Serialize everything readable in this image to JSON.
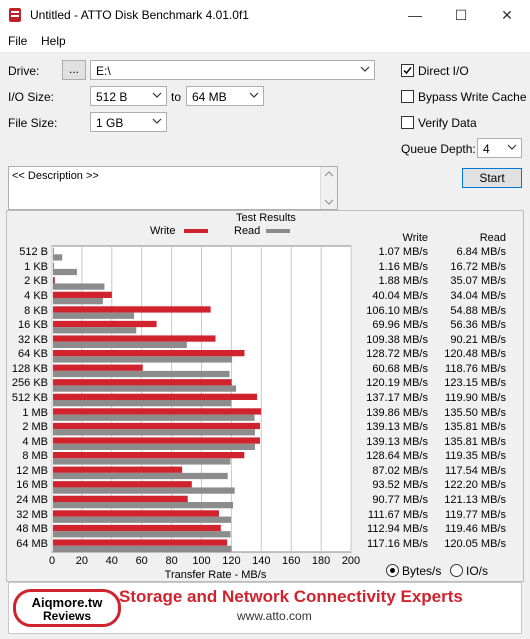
{
  "window": {
    "title": "Untitled - ATTO Disk Benchmark 4.01.0f1",
    "minimize_glyph": "—",
    "maximize_glyph": "☐",
    "close_glyph": "✕"
  },
  "menu": {
    "file": "File",
    "help": "Help"
  },
  "settings": {
    "drive_label": "Drive:",
    "browse_button": "...",
    "drive_value": "E:\\",
    "io_size_label": "I/O Size:",
    "io_from": "512 B",
    "io_to_label": "to",
    "io_to": "64 MB",
    "file_size_label": "File Size:",
    "file_size_value": "1 GB",
    "direct_io_label": "Direct I/O",
    "direct_io_checked": true,
    "bypass_cache_label": "Bypass Write Cache",
    "bypass_cache_checked": false,
    "verify_label": "Verify Data",
    "verify_checked": false,
    "queue_depth_label": "Queue Depth:",
    "queue_depth_value": "4",
    "start_button": "Start"
  },
  "description": {
    "text": "<< Description >>"
  },
  "results": {
    "title": "Test Results",
    "legend_write": "Write",
    "legend_read": "Read",
    "col_write": "Write",
    "col_read": "Read",
    "write_color": "#d0232e",
    "read_color": "#8c8c8c",
    "units_bytes": "Bytes/s",
    "units_io": "IO/s",
    "units_selected": "bytes",
    "rows": [
      {
        "size": "512 B",
        "write": "1.07 MB/s",
        "read": "6.84 MB/s"
      },
      {
        "size": "1 KB",
        "write": "1.16 MB/s",
        "read": "16.72 MB/s"
      },
      {
        "size": "2 KB",
        "write": "1.88 MB/s",
        "read": "35.07 MB/s"
      },
      {
        "size": "4 KB",
        "write": "40.04 MB/s",
        "read": "34.04 MB/s"
      },
      {
        "size": "8 KB",
        "write": "106.10 MB/s",
        "read": "54.88 MB/s"
      },
      {
        "size": "16 KB",
        "write": "69.96 MB/s",
        "read": "56.36 MB/s"
      },
      {
        "size": "32 KB",
        "write": "109.38 MB/s",
        "read": "90.21 MB/s"
      },
      {
        "size": "64 KB",
        "write": "128.72 MB/s",
        "read": "120.48 MB/s"
      },
      {
        "size": "128 KB",
        "write": "60.68 MB/s",
        "read": "118.76 MB/s"
      },
      {
        "size": "256 KB",
        "write": "120.19 MB/s",
        "read": "123.15 MB/s"
      },
      {
        "size": "512 KB",
        "write": "137.17 MB/s",
        "read": "119.90 MB/s"
      },
      {
        "size": "1 MB",
        "write": "139.86 MB/s",
        "read": "135.50 MB/s"
      },
      {
        "size": "2 MB",
        "write": "139.13 MB/s",
        "read": "135.81 MB/s"
      },
      {
        "size": "4 MB",
        "write": "139.13 MB/s",
        "read": "135.81 MB/s"
      },
      {
        "size": "8 MB",
        "write": "128.64 MB/s",
        "read": "119.35 MB/s"
      },
      {
        "size": "12 MB",
        "write": "87.02 MB/s",
        "read": "117.54 MB/s"
      },
      {
        "size": "16 MB",
        "write": "93.52 MB/s",
        "read": "122.20 MB/s"
      },
      {
        "size": "24 MB",
        "write": "90.77 MB/s",
        "read": "121.13 MB/s"
      },
      {
        "size": "32 MB",
        "write": "111.67 MB/s",
        "read": "119.77 MB/s"
      },
      {
        "size": "48 MB",
        "write": "112.94 MB/s",
        "read": "119.46 MB/s"
      },
      {
        "size": "64 MB",
        "write": "117.16 MB/s",
        "read": "120.05 MB/s"
      }
    ]
  },
  "chart_data": {
    "type": "bar",
    "orientation": "horizontal",
    "title": "Test Results",
    "xlabel": "Transfer Rate - MB/s",
    "xlim": [
      0,
      200
    ],
    "xticks": [
      "0",
      "20",
      "40",
      "60",
      "80",
      "100",
      "120",
      "140",
      "160",
      "180",
      "200"
    ],
    "grid": true,
    "categories": [
      "512 B",
      "1 KB",
      "2 KB",
      "4 KB",
      "8 KB",
      "16 KB",
      "32 KB",
      "64 KB",
      "128 KB",
      "256 KB",
      "512 KB",
      "1 MB",
      "2 MB",
      "4 MB",
      "8 MB",
      "12 MB",
      "16 MB",
      "24 MB",
      "32 MB",
      "48 MB",
      "64 MB"
    ],
    "series": [
      {
        "name": "Write",
        "color": "#d0232e",
        "values": [
          1.07,
          1.16,
          1.88,
          40.04,
          106.1,
          69.96,
          109.38,
          128.72,
          60.68,
          120.19,
          137.17,
          139.86,
          139.13,
          139.13,
          128.64,
          87.02,
          93.52,
          90.77,
          111.67,
          112.94,
          117.16
        ]
      },
      {
        "name": "Read",
        "color": "#8c8c8c",
        "values": [
          6.84,
          16.72,
          35.07,
          34.04,
          54.88,
          56.36,
          90.21,
          120.48,
          118.76,
          123.15,
          119.9,
          135.5,
          135.81,
          135.81,
          119.35,
          117.54,
          122.2,
          121.13,
          119.77,
          119.46,
          120.05
        ]
      }
    ]
  },
  "footer": {
    "watermark_line1": "Aiqmore.tw",
    "watermark_line2": "Reviews",
    "tagline": "Storage and Network Connectivity Experts",
    "url": "www.atto.com"
  }
}
